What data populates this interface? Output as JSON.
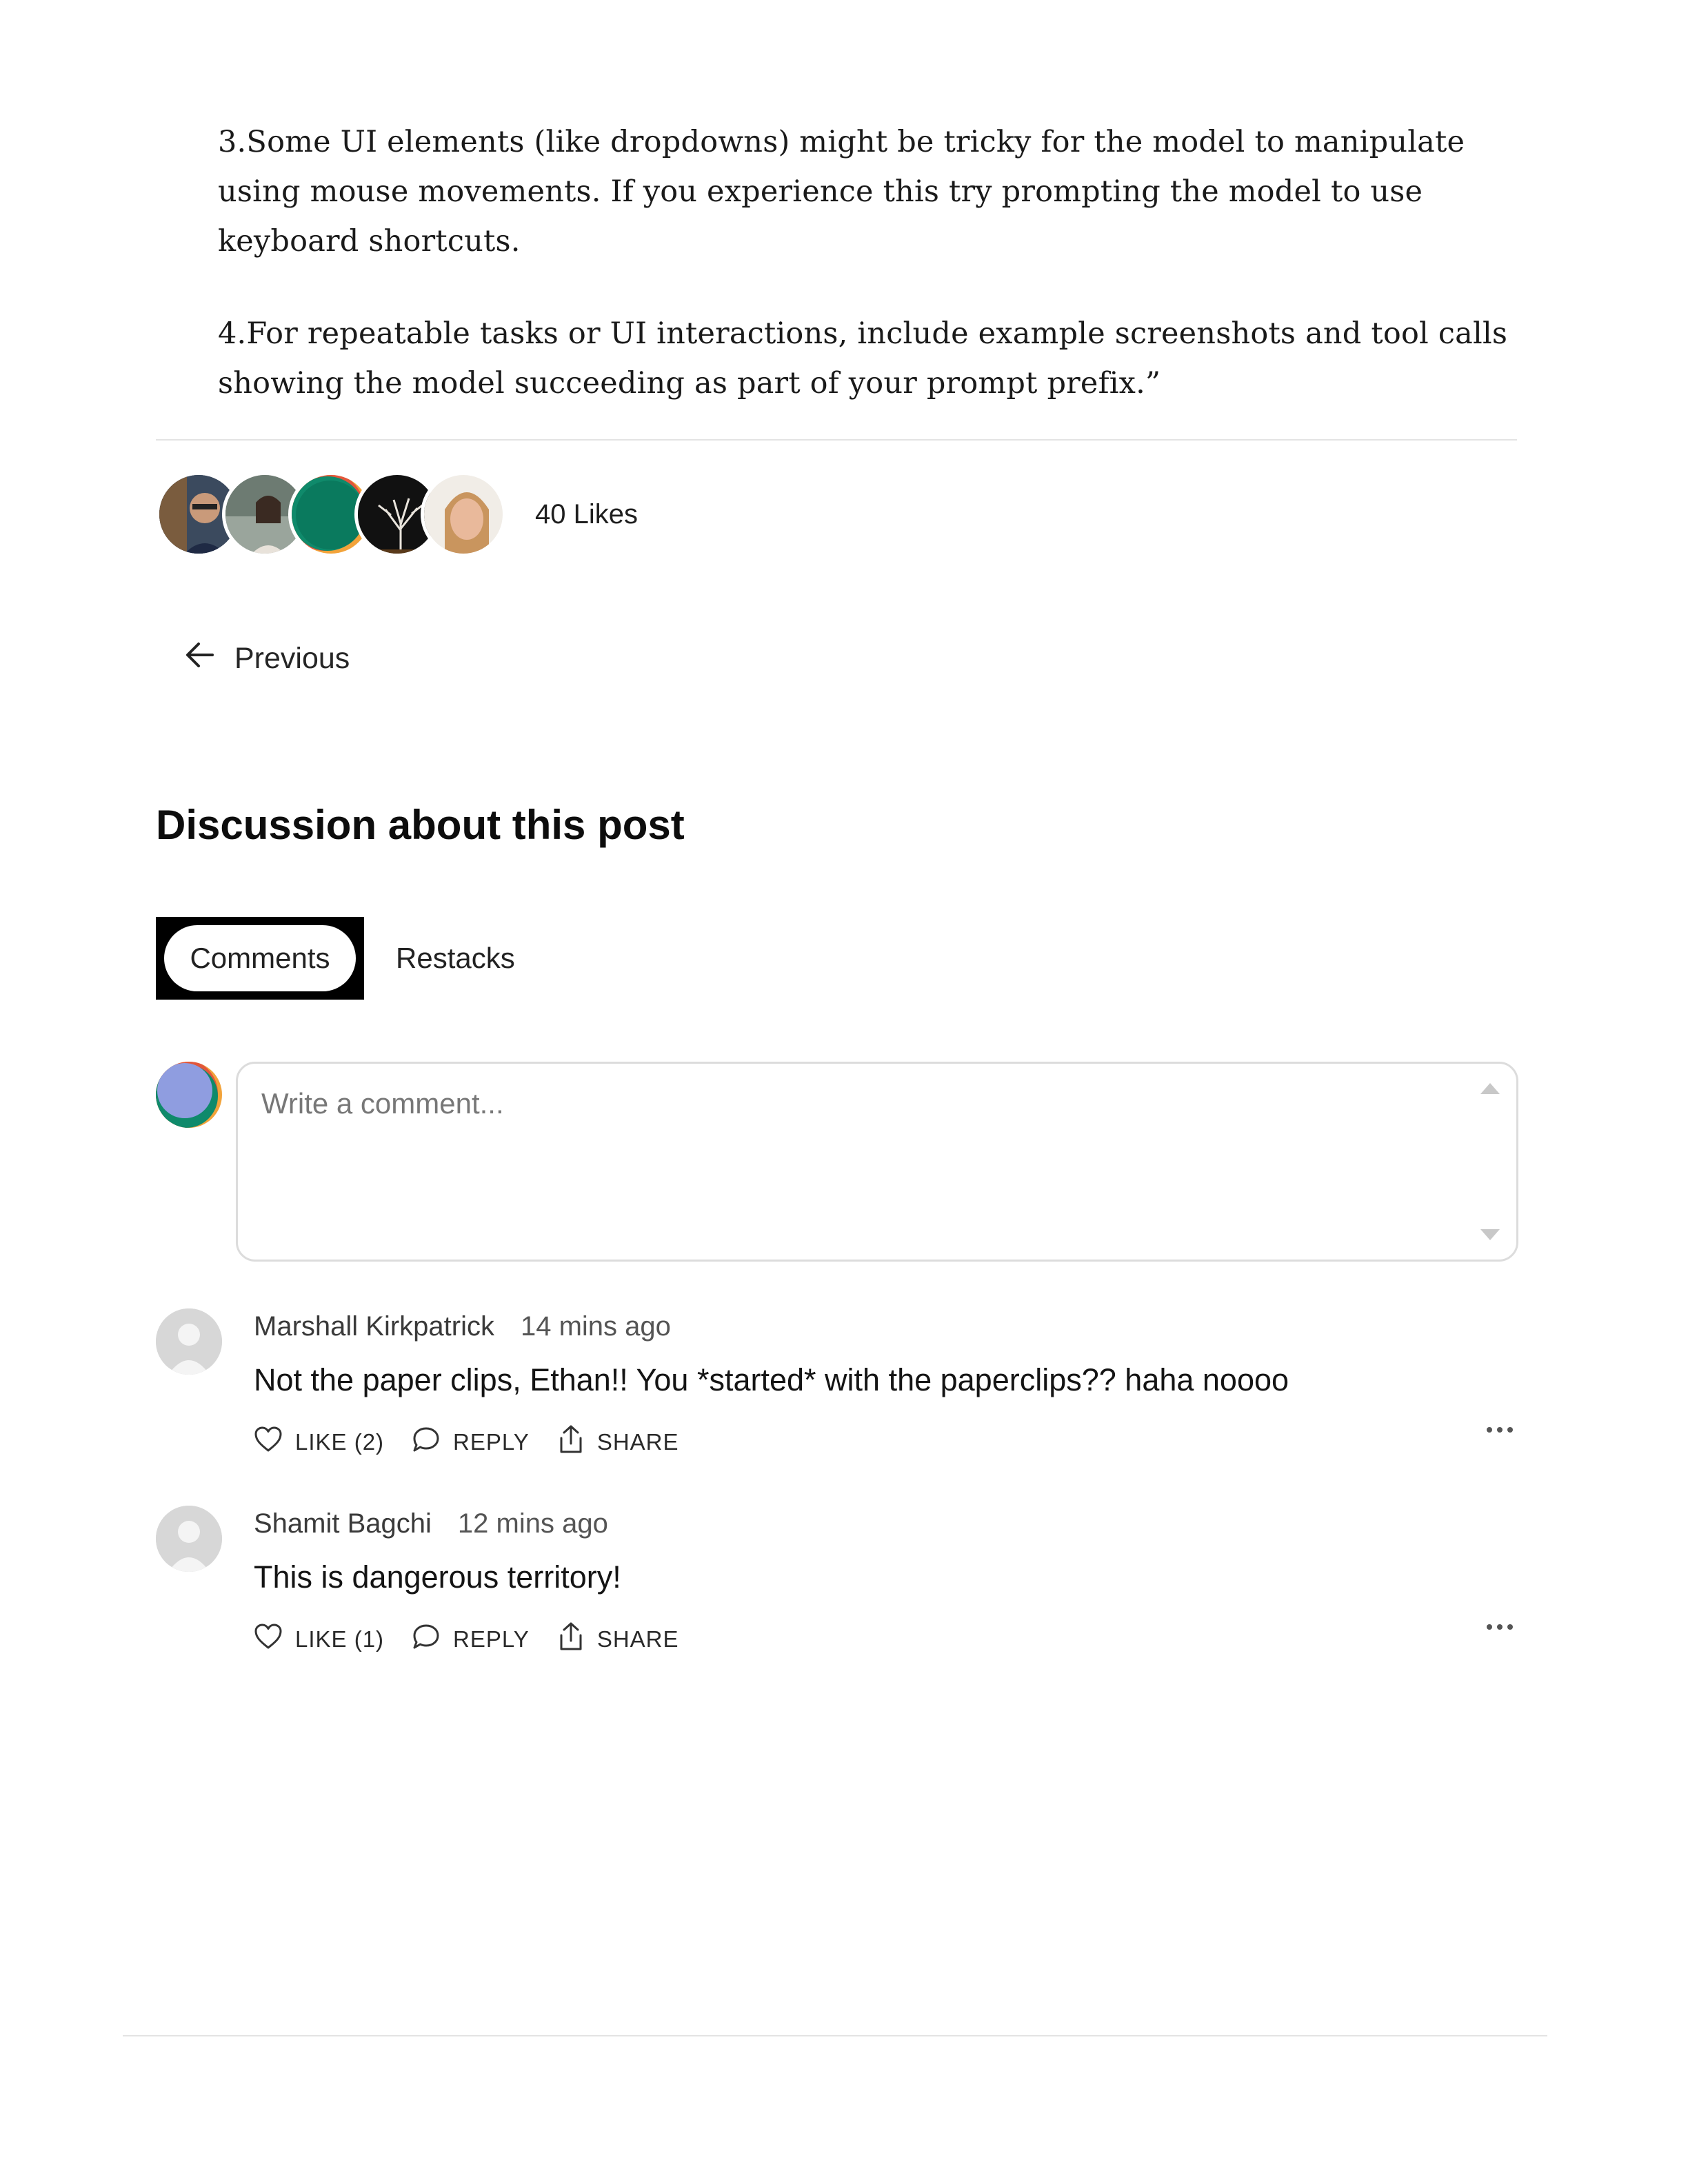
{
  "article": {
    "paragraphs": [
      "3.Some UI elements (like dropdowns) might be tricky for the model to manipulate using mouse movements. If you experience this try prompting the model to use keyboard shortcuts.",
      "4.For repeatable tasks or UI interactions, include example screenshots and tool calls showing the model succeeding as part of your prompt prefix.”"
    ]
  },
  "likes": {
    "label": "40 Likes"
  },
  "navigation": {
    "previous_label": "Previous"
  },
  "discussion": {
    "title": "Discussion about this post",
    "tabs": [
      {
        "label": "Comments",
        "active": true
      },
      {
        "label": "Restacks",
        "active": false
      }
    ],
    "composer": {
      "placeholder": "Write a comment..."
    },
    "comments": [
      {
        "author": "Marshall Kirkpatrick",
        "time": "14 mins ago",
        "body": "Not the paper clips, Ethan!! You *started* with the paperclips?? haha noooo",
        "like_label": "LIKE (2)",
        "reply_label": "REPLY",
        "share_label": "SHARE"
      },
      {
        "author": "Shamit Bagchi",
        "time": "12 mins ago",
        "body": "This is dangerous territory!",
        "like_label": "LIKE (1)",
        "reply_label": "REPLY",
        "share_label": "SHARE"
      }
    ]
  },
  "icons": {
    "previous": "arrow-left-icon",
    "like": "heart-icon",
    "reply": "speech-bubble-icon",
    "share": "share-upload-icon",
    "more": "ellipsis-icon"
  },
  "colors": {
    "tab_active_frame": "#000000",
    "divider": "#e3e3e3",
    "text_secondary": "#555555"
  }
}
